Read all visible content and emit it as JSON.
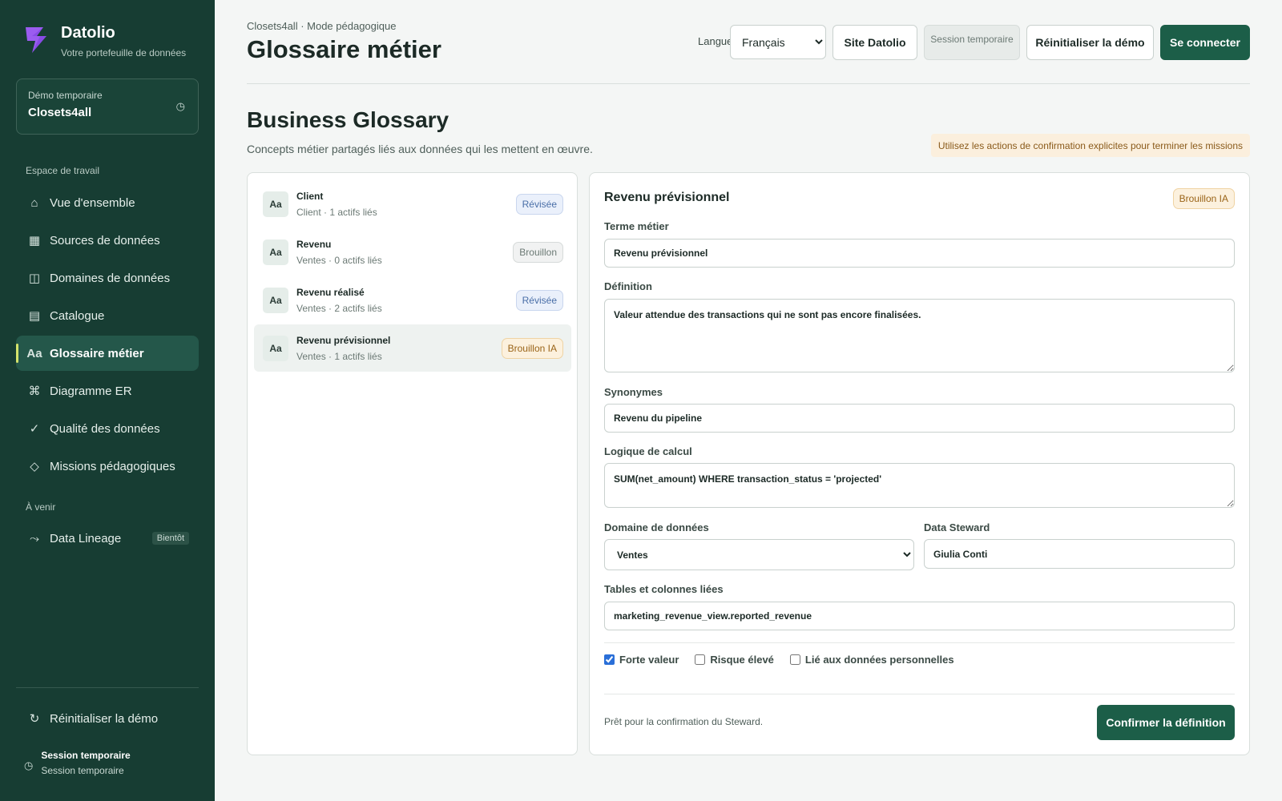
{
  "brand": {
    "name": "Datolio",
    "tagline": "Votre portefeuille de données"
  },
  "demo_card": {
    "label": "Démo temporaire",
    "name": "Closets4all"
  },
  "sidebar": {
    "workspace_label": "Espace de travail",
    "items": [
      {
        "label": "Vue d'ensemble",
        "icon": "home-icon",
        "glyph": "⌂"
      },
      {
        "label": "Sources de données",
        "icon": "grid-icon",
        "glyph": "▦"
      },
      {
        "label": "Domaines de données",
        "icon": "columns-icon",
        "glyph": "◫"
      },
      {
        "label": "Catalogue",
        "icon": "list-icon",
        "glyph": "▤"
      },
      {
        "label": "Glossaire métier",
        "icon": "text-icon",
        "glyph": "Aa",
        "active": true
      },
      {
        "label": "Diagramme ER",
        "icon": "command-icon",
        "glyph": "⌘"
      },
      {
        "label": "Qualité des données",
        "icon": "check-icon",
        "glyph": "✓"
      },
      {
        "label": "Missions pédagogiques",
        "icon": "diamond-icon",
        "glyph": "◇"
      }
    ],
    "upcoming_label": "À venir",
    "upcoming_item": {
      "label": "Data Lineage",
      "badge": "Bientôt",
      "icon": "lineage-icon",
      "glyph": "⤳"
    },
    "reset_label": "Réinitialiser la démo",
    "session_title": "Session temporaire",
    "session_sub": "Session temporaire"
  },
  "header": {
    "breadcrumb": "Closets4all · Mode pédagogique",
    "title": "Glossaire métier",
    "lang_label": "Langue",
    "lang_value": "Français",
    "site_button": "Site Datolio",
    "session_badge": "Session temporaire",
    "reset_button": "Réinitialiser la démo",
    "login_button": "Se connecter"
  },
  "section": {
    "title": "Business Glossary",
    "description": "Concepts métier partagés liés aux données qui les mettent en œuvre.",
    "hint": "Utilisez les actions de confirmation explicites pour terminer les missions"
  },
  "terms": [
    {
      "name": "Client",
      "meta": "Client · 1 actifs liés",
      "status": "Révisée",
      "status_type": "revised"
    },
    {
      "name": "Revenu",
      "meta": "Ventes · 0 actifs liés",
      "status": "Brouillon",
      "status_type": "draft"
    },
    {
      "name": "Revenu réalisé",
      "meta": "Ventes · 2 actifs liés",
      "status": "Révisée",
      "status_type": "revised"
    },
    {
      "name": "Revenu prévisionnel",
      "meta": "Ventes · 1 actifs liés",
      "status": "Brouillon IA",
      "status_type": "ai",
      "selected": true
    }
  ],
  "term_icon_text": "Aa",
  "detail": {
    "title": "Revenu prévisionnel",
    "status": "Brouillon IA",
    "term_label": "Terme métier",
    "term_value": "Revenu prévisionnel",
    "definition_label": "Définition",
    "definition_value": "Valeur attendue des transactions qui ne sont pas encore finalisées.",
    "synonyms_label": "Synonymes",
    "synonyms_value": "Revenu du pipeline",
    "logic_label": "Logique de calcul",
    "logic_value": "SUM(net_amount) WHERE transaction_status = 'projected'",
    "domain_label": "Domaine de données",
    "domain_value": "Ventes",
    "steward_label": "Data Steward",
    "steward_value": "Giulia Conti",
    "tables_label": "Tables et colonnes liées",
    "tables_value": "marketing_revenue_view.reported_revenue",
    "checkboxes": [
      {
        "label": "Forte valeur",
        "checked": true
      },
      {
        "label": "Risque élevé",
        "checked": false
      },
      {
        "label": "Lié aux données personnelles",
        "checked": false
      }
    ],
    "footer_note": "Prêt pour la confirmation du Steward.",
    "confirm_button": "Confirmer la définition"
  },
  "colors": {
    "sidebar_bg": "#173d33",
    "primary": "#1c5e48",
    "accent": "#d4e36b"
  }
}
